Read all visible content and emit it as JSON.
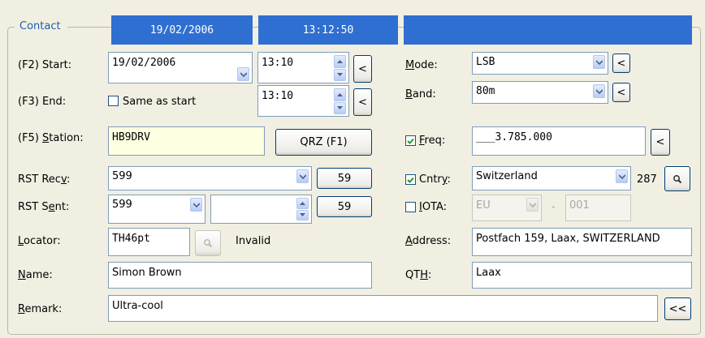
{
  "group_title": "Contact",
  "banner": {
    "date": "19/02/2006",
    "time": "13:12:50",
    "right": ""
  },
  "start": {
    "label": "(F2) Start:",
    "date": "19/02/2006",
    "time": "13:10",
    "btn": "<"
  },
  "end": {
    "label": "(F3) End:",
    "same_as_start": "Same as start",
    "time": "13:10",
    "btn": "<"
  },
  "station": {
    "label_pre": "(F5) ",
    "label_u": "S",
    "label_post": "tation:",
    "value": "HB9DRV",
    "qrz_label": "QRZ (F1)"
  },
  "rst_recv": {
    "label_pre": "RST Rec",
    "label_u": "v",
    "label_post": ":",
    "value": "599",
    "btn": "59"
  },
  "rst_sent": {
    "label_pre": "RST S",
    "label_u": "e",
    "label_post": "nt:",
    "value": "599",
    "extra": "",
    "btn": "59"
  },
  "locator": {
    "label_u": "L",
    "label_post": "ocator:",
    "value": "TH46pt",
    "status": "Invalid",
    "icon": "search-icon"
  },
  "name": {
    "label_u": "N",
    "label_post": "ame:",
    "value": "Simon Brown"
  },
  "remark": {
    "label_u": "R",
    "label_post": "emark:",
    "value": "Ultra-cool",
    "btn": "<<"
  },
  "mode": {
    "label_u": "M",
    "label_post": "ode:",
    "value": "LSB",
    "btn": "<"
  },
  "band": {
    "label_u": "B",
    "label_post": "and:",
    "value": "80m",
    "btn": "<"
  },
  "freq": {
    "label_u": "F",
    "label_post": "req:",
    "checked": true,
    "value": "___3.785.000",
    "btn": "<"
  },
  "cntry": {
    "label_pre": "Cntr",
    "label_u": "y",
    "label_post": ":",
    "checked": true,
    "value": "Switzerland",
    "number": "287",
    "icon": "search-icon"
  },
  "iota": {
    "label_u": "I",
    "label_post": "OTA:",
    "checked": false,
    "continent": "EU",
    "dash": "-",
    "number": "001"
  },
  "address": {
    "label_pre": "",
    "label_u": "A",
    "label_post": "ddress:",
    "value": "Postfach 159, Laax, SWITZERLAND"
  },
  "qth": {
    "label_pre": "QT",
    "label_u": "H",
    "label_post": ":",
    "value": "Laax"
  },
  "colors": {
    "banner": "#2f6fd1",
    "title": "#1c5fb0",
    "station_bg": "#ffffe1"
  }
}
